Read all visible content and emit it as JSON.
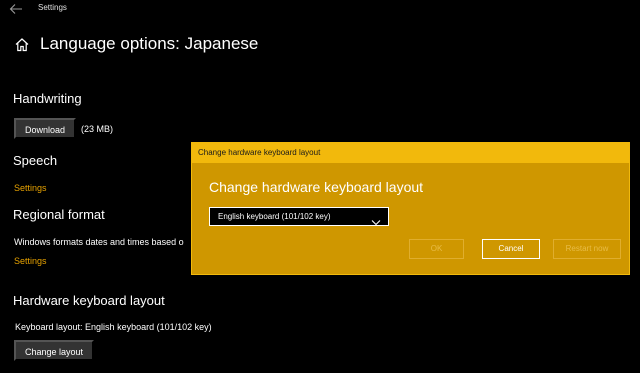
{
  "window": {
    "title": "Settings",
    "back_icon": "back-arrow-icon"
  },
  "page": {
    "home_icon": "home-icon",
    "title": "Language options: Japanese"
  },
  "handwriting": {
    "heading": "Handwriting",
    "download_label": "Download",
    "size": "(23 MB)"
  },
  "speech": {
    "heading": "Speech",
    "settings_link": "Settings"
  },
  "regional": {
    "heading": "Regional format",
    "description": "Windows formats dates and times based o",
    "settings_link": "Settings"
  },
  "keyboard": {
    "heading": "Hardware keyboard layout",
    "status": "Keyboard layout:  English keyboard (101/102 key)",
    "change_label": "Change layout"
  },
  "dialog": {
    "titlebar": "Change hardware keyboard layout",
    "heading": "Change hardware keyboard layout",
    "selected_layout": "English keyboard (101/102 key)",
    "ok_label": "OK",
    "cancel_label": "Cancel",
    "restart_label": "Restart now"
  },
  "colors": {
    "accent": "#e6a100",
    "dialog_background": "#cf9700",
    "dialog_titlebar": "#f2b90c",
    "page_background": "#000000"
  }
}
